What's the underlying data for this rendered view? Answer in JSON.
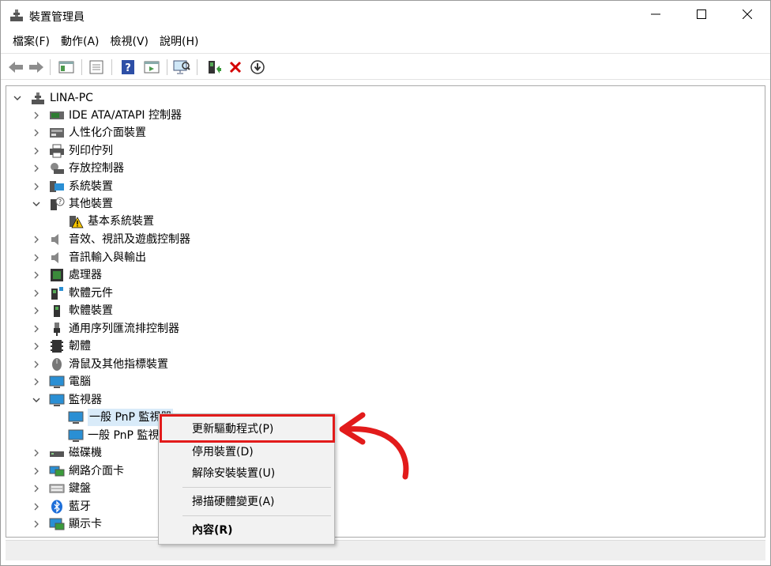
{
  "window": {
    "title": "裝置管理員",
    "controls": {
      "minimize": "minimize-icon",
      "maximize": "maximize-icon",
      "close": "close-icon"
    }
  },
  "menu": [
    "檔案(F)",
    "動作(A)",
    "檢視(V)",
    "說明(H)"
  ],
  "toolbar": [
    "back-icon",
    "forward-icon",
    "show-hide-console-tree-icon",
    "properties-icon",
    "help-icon",
    "run-icon",
    "scan-hardware-icon",
    "update-driver-icon",
    "uninstall-icon",
    "disable-icon"
  ],
  "tree": {
    "root": "LINA-PC",
    "items": [
      {
        "label": "IDE ATA/ATAPI 控制器",
        "expanded": false
      },
      {
        "label": "人性化介面裝置",
        "expanded": false
      },
      {
        "label": "列印佇列",
        "expanded": false
      },
      {
        "label": "存放控制器",
        "expanded": false
      },
      {
        "label": "系統裝置",
        "expanded": false
      },
      {
        "label": "其他裝置",
        "expanded": true,
        "children": [
          "基本系統裝置"
        ]
      },
      {
        "label": "音效、視訊及遊戲控制器",
        "expanded": false
      },
      {
        "label": "音訊輸入與輸出",
        "expanded": false
      },
      {
        "label": "處理器",
        "expanded": false
      },
      {
        "label": "軟體元件",
        "expanded": false
      },
      {
        "label": "軟體裝置",
        "expanded": false
      },
      {
        "label": "通用序列匯流排控制器",
        "expanded": false
      },
      {
        "label": "韌體",
        "expanded": false
      },
      {
        "label": "滑鼠及其他指標裝置",
        "expanded": false
      },
      {
        "label": "電腦",
        "expanded": false
      },
      {
        "label": "監視器",
        "expanded": true,
        "children": [
          "一般 PnP 監視器",
          "一般 PnP 監視"
        ]
      },
      {
        "label": "磁碟機",
        "expanded": false
      },
      {
        "label": "網路介面卡",
        "expanded": false
      },
      {
        "label": "鍵盤",
        "expanded": false
      },
      {
        "label": "藍牙",
        "expanded": false
      },
      {
        "label": "顯示卡",
        "expanded": false
      }
    ]
  },
  "context_menu": {
    "items": [
      {
        "label": "更新驅動程式(P)",
        "highlighted": true
      },
      {
        "label": "停用裝置(D)"
      },
      {
        "label": "解除安裝裝置(U)"
      },
      {
        "label": "掃描硬體變更(A)"
      },
      {
        "label": "內容(R)",
        "bold": true
      }
    ]
  },
  "colors": {
    "highlight": "#e21b1b",
    "selection": "#d9ebf9",
    "menu_bg": "#f2f2f2"
  }
}
